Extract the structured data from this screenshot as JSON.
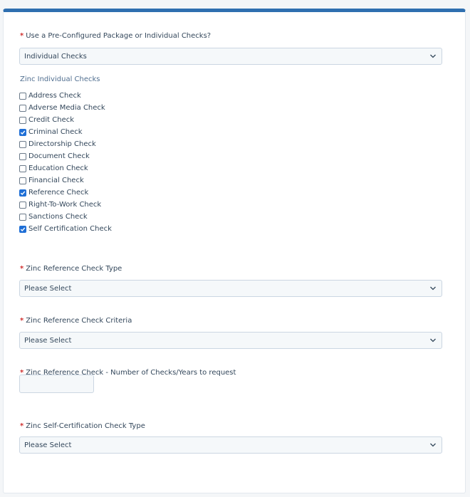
{
  "package": {
    "label": "Use a Pre-Configured Package or Individual Checks?",
    "value": "Individual Checks"
  },
  "checks_section": {
    "label": "Zinc Individual Checks",
    "items": [
      {
        "label": "Address Check",
        "checked": false
      },
      {
        "label": "Adverse Media Check",
        "checked": false
      },
      {
        "label": "Credit Check",
        "checked": false
      },
      {
        "label": "Criminal Check",
        "checked": true
      },
      {
        "label": "Directorship Check",
        "checked": false
      },
      {
        "label": "Document Check",
        "checked": false
      },
      {
        "label": "Education Check",
        "checked": false
      },
      {
        "label": "Financial Check",
        "checked": false
      },
      {
        "label": "Reference Check",
        "checked": true
      },
      {
        "label": "Right-To-Work Check",
        "checked": false
      },
      {
        "label": "Sanctions Check",
        "checked": false
      },
      {
        "label": "Self Certification Check",
        "checked": true
      }
    ]
  },
  "ref_type": {
    "label": "Zinc Reference Check Type",
    "value": "Please Select"
  },
  "ref_criteria": {
    "label": "Zinc Reference Check Criteria",
    "value": "Please Select"
  },
  "ref_count": {
    "label": "Zinc Reference Check - Number of Checks/Years to request",
    "value": ""
  },
  "self_cert": {
    "label": "Zinc Self-Certification Check Type",
    "value": "Please Select"
  },
  "required_marker": "*",
  "colors": {
    "accent_bar": "#2f6fb0",
    "required": "#d0302f",
    "checkbox_checked": "#1f6fd6"
  }
}
